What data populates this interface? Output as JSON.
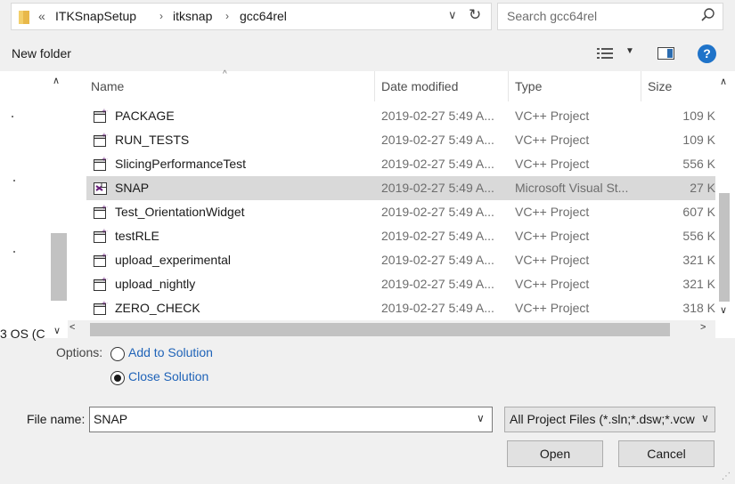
{
  "address": {
    "back_chevron": "«",
    "crumbs": [
      "ITKSnapSetup",
      "itksnap",
      "gcc64rel"
    ],
    "separator": "›"
  },
  "search": {
    "placeholder": "Search gcc64rel"
  },
  "toolbar": {
    "new_folder": "New folder",
    "help": "?"
  },
  "columns": {
    "name": "Name",
    "date": "Date modified",
    "type": "Type",
    "size": "Size"
  },
  "files": [
    {
      "name": "PACKAGE",
      "date": "2019-02-27 5:49 A...",
      "type": "VC++ Project",
      "size": "109 K",
      "icon": "vcxproj-icon"
    },
    {
      "name": "RUN_TESTS",
      "date": "2019-02-27 5:49 A...",
      "type": "VC++ Project",
      "size": "109 K",
      "icon": "vcxproj-icon"
    },
    {
      "name": "SlicingPerformanceTest",
      "date": "2019-02-27 5:49 A...",
      "type": "VC++ Project",
      "size": "556 K",
      "icon": "vcxproj-icon"
    },
    {
      "name": "SNAP",
      "date": "2019-02-27 5:49 A...",
      "type": "Microsoft Visual St...",
      "size": "27 K",
      "icon": "vs-solution-icon",
      "selected": true
    },
    {
      "name": "Test_OrientationWidget",
      "date": "2019-02-27 5:49 A...",
      "type": "VC++ Project",
      "size": "607 K",
      "icon": "vcxproj-icon"
    },
    {
      "name": "testRLE",
      "date": "2019-02-27 5:49 A...",
      "type": "VC++ Project",
      "size": "556 K",
      "icon": "vcxproj-icon"
    },
    {
      "name": "upload_experimental",
      "date": "2019-02-27 5:49 A...",
      "type": "VC++ Project",
      "size": "321 K",
      "icon": "vcxproj-icon"
    },
    {
      "name": "upload_nightly",
      "date": "2019-02-27 5:49 A...",
      "type": "VC++ Project",
      "size": "321 K",
      "icon": "vcxproj-icon"
    },
    {
      "name": "ZERO_CHECK",
      "date": "2019-02-27 5:49 A...",
      "type": "VC++ Project",
      "size": "318 K",
      "icon": "vcxproj-icon"
    }
  ],
  "nav": {
    "partial_item": "3 OS (C"
  },
  "options": {
    "label": "Options:",
    "add_to_solution": "Add to Solution",
    "close_solution": "Close Solution",
    "selected": "close_solution"
  },
  "file_name": {
    "label": "File name:",
    "value": "SNAP"
  },
  "file_type": {
    "value": "All Project Files (*.sln;*.dsw;*.vcw"
  },
  "buttons": {
    "open": "Open",
    "cancel": "Cancel"
  },
  "colors": {
    "accent": "#1f73c9",
    "link": "#1f63b8",
    "selected_row": "#d9d9d9",
    "vs_purple": "#68217a"
  }
}
